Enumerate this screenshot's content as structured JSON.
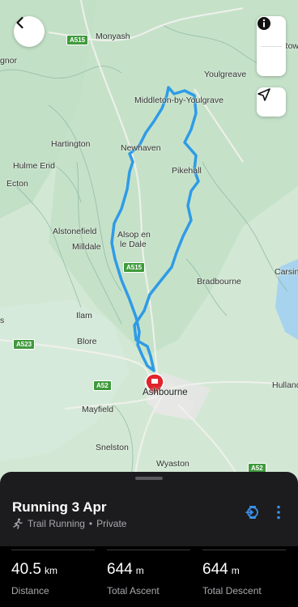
{
  "map": {
    "places": [
      {
        "name": "Monyash"
      },
      {
        "name": "Youlgreave"
      },
      {
        "name": "Middleton-by-Youlgrave"
      },
      {
        "name": "Hartington"
      },
      {
        "name": "Newhaven"
      },
      {
        "name": "Hulme End"
      },
      {
        "name": "Pikehall"
      },
      {
        "name": "Ecton"
      },
      {
        "name": "Alstonefield"
      },
      {
        "name": "Alsop en"
      },
      {
        "name": "le Dale"
      },
      {
        "name": "Milldale"
      },
      {
        "name": "Bradbourne"
      },
      {
        "name": "Carsin"
      },
      {
        "name": "Ilam"
      },
      {
        "name": "Blore"
      },
      {
        "name": "Ashbourne"
      },
      {
        "name": "Hulland"
      },
      {
        "name": "Mayfield"
      },
      {
        "name": "Snelston"
      },
      {
        "name": "Wyaston"
      },
      {
        "name": "gnor"
      },
      {
        "name": "Row"
      },
      {
        "name": "E"
      },
      {
        "name": "s"
      }
    ],
    "roads": [
      "A515",
      "A515",
      "A523",
      "A52",
      "A52"
    ],
    "route_color": "#2f9be6",
    "marker_color": "#e0242c"
  },
  "activity": {
    "title": "Running 3 Apr",
    "type": "Trail Running",
    "separator": "•",
    "privacy": "Private"
  },
  "stats": [
    {
      "value": "40.5",
      "unit": "km",
      "label": "Distance"
    },
    {
      "value": "644",
      "unit": "m",
      "label": "Total Ascent"
    },
    {
      "value": "644",
      "unit": "m",
      "label": "Total Descent"
    }
  ],
  "icons": {
    "back": "chevron-left-icon",
    "layers": "layers-icon",
    "info": "info-icon",
    "locate": "location-arrow-icon",
    "device": "watch-sync-icon",
    "more": "more-vertical-icon",
    "activity": "running-icon"
  }
}
